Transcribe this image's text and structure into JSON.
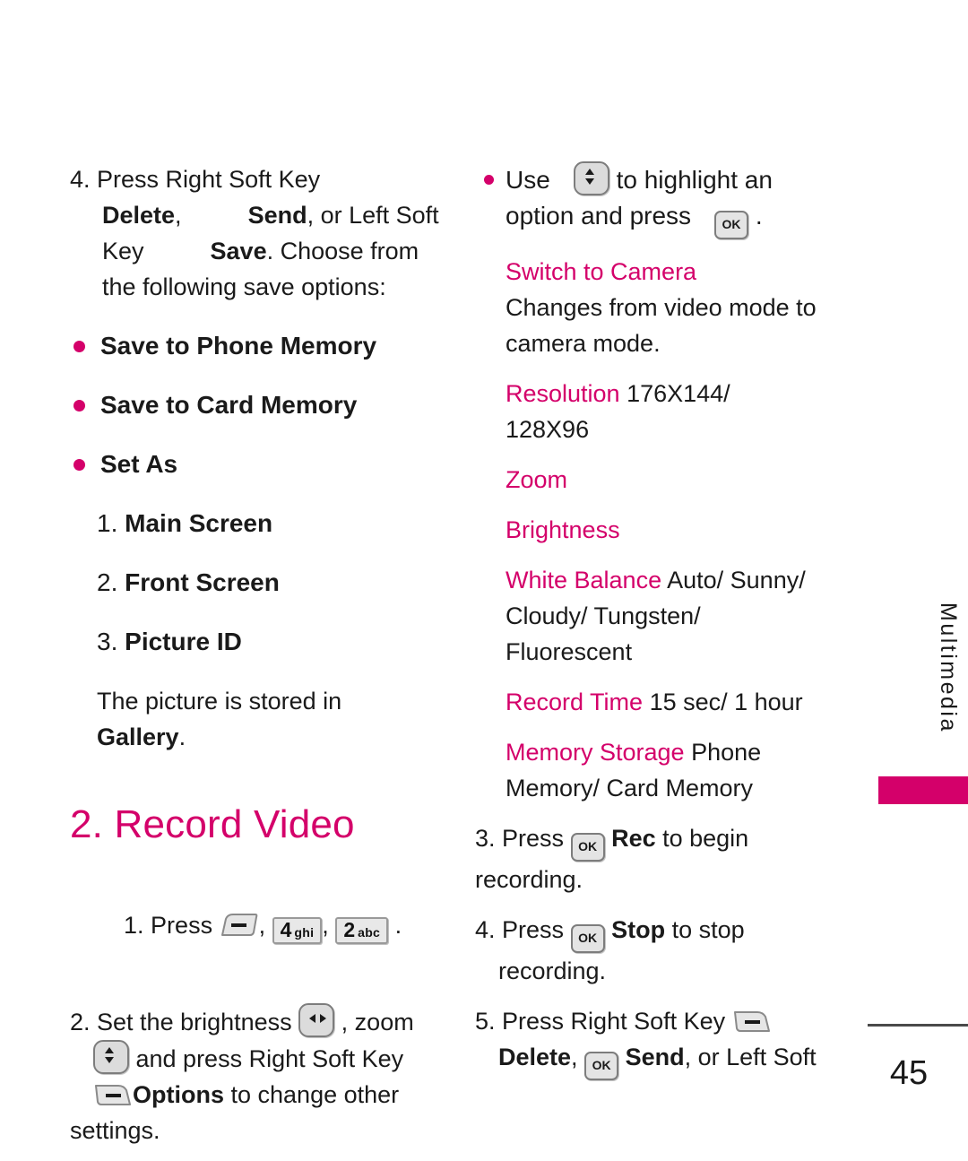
{
  "page": {
    "number": "45",
    "side_tab_label": "Multimedia",
    "accent_color": "#D4006A"
  },
  "left_column": {
    "step4": {
      "line1_num": "4.",
      "line1": " Press Right Soft Key",
      "line2_delete": "Delete",
      "line2_comma": ",",
      "line2_send": "Send",
      "line2_rest": ", or Left Soft",
      "line3_key": "Key",
      "line3_save": "Save",
      "line3_rest": ". Choose from",
      "line4": "the following save options:"
    },
    "save_options": [
      "Save to Phone Memory",
      "Save to Card Memory",
      "Set As"
    ],
    "set_as_items": [
      {
        "num": "1.",
        "label": "Main Screen"
      },
      {
        "num": "2.",
        "label": "Front Screen"
      },
      {
        "num": "3.",
        "label": "Picture ID"
      }
    ],
    "stored_note_text": "The picture is stored in",
    "stored_note_bold": "Gallery",
    "stored_note_period": ".",
    "section_heading": "2. Record Video",
    "record_steps": {
      "step1_num": "1.",
      "step1_press": " Press ",
      "step1_key1_icon": "right-soft-key-icon",
      "step1_comma1": ", ",
      "step1_key2_digit": "4",
      "step1_key2_letters": "ghi",
      "step1_comma2": ", ",
      "step1_key3_digit": "2",
      "step1_key3_letters": "abc",
      "step1_period": " .",
      "step2_num": "2.",
      "step2_a": " Set the brightness ",
      "step2_b": " , zoom",
      "step2_c": " and press Right Soft Key",
      "step2_options": "Options",
      "step2_d": " to change other",
      "step2_e": "settings."
    }
  },
  "right_column": {
    "use_bullet": {
      "use": "Use",
      "to_highlight": " to highlight an",
      "option_and_press": "option and press",
      "period": "."
    },
    "options": [
      {
        "name": "Switch to Camera",
        "value": "",
        "description_lines": [
          "Changes from video mode to",
          "camera mode."
        ]
      },
      {
        "name": "Resolution",
        "value": " 176X144/",
        "description_lines": [
          "128X96"
        ]
      },
      {
        "name": "Zoom",
        "value": "",
        "description_lines": []
      },
      {
        "name": "Brightness",
        "value": "",
        "description_lines": []
      },
      {
        "name": "White Balance",
        "value": " Auto/ Sunny/",
        "description_lines": [
          "Cloudy/ Tungsten/",
          "Fluorescent"
        ]
      },
      {
        "name": "Record Time",
        "value": " 15 sec/ 1 hour",
        "description_lines": []
      },
      {
        "name": "Memory Storage",
        "value": " Phone",
        "description_lines": [
          "Memory/ Card Memory"
        ]
      }
    ],
    "steps": {
      "step3_num": "3.",
      "step3_press": " Press ",
      "step3_rec": "Rec",
      "step3_rest": " to begin",
      "step3_line2": "recording.",
      "step4_num": "4.",
      "step4_press": " Press ",
      "step4_stop": "Stop",
      "step4_rest": " to stop",
      "step4_line2": "recording.",
      "step5_num": "5.",
      "step5_press": " Press Right Soft Key ",
      "step5_delete": "Delete",
      "step5_comma": ", ",
      "step5_send": "Send",
      "step5_rest": ", or Left Soft"
    }
  }
}
